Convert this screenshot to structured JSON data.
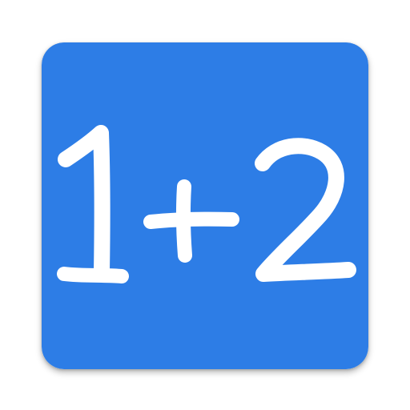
{
  "icon": {
    "text": "1+2",
    "glyphs": [
      "1",
      "+",
      "2"
    ],
    "background_color": "#2d7de6",
    "glyph_color": "#ffffff",
    "name": "math-addition-app-icon"
  }
}
